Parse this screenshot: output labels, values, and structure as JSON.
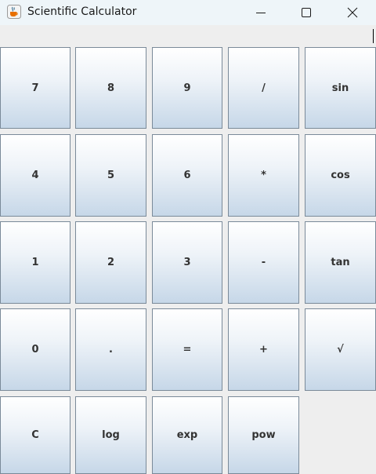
{
  "window": {
    "title": "Scientific Calculator",
    "icon": "java-cup-icon",
    "controls": [
      "minimize-icon",
      "maximize-icon",
      "close-icon"
    ]
  },
  "display": {
    "value": ""
  },
  "keys": {
    "row1": [
      "7",
      "8",
      "9",
      "/",
      "sin"
    ],
    "row2": [
      "4",
      "5",
      "6",
      "*",
      "cos"
    ],
    "row3": [
      "1",
      "2",
      "3",
      "-",
      "tan"
    ],
    "row4": [
      "0",
      ".",
      "=",
      "+",
      "√"
    ],
    "row5": [
      "C",
      "log",
      "exp",
      "pow"
    ]
  },
  "colors": {
    "key_gradient_top": "#ffffff",
    "key_gradient_bottom": "#c6d7e8",
    "key_border": "#7a8a99",
    "titlebar": "#eef5f9",
    "background": "#eeeeee"
  }
}
